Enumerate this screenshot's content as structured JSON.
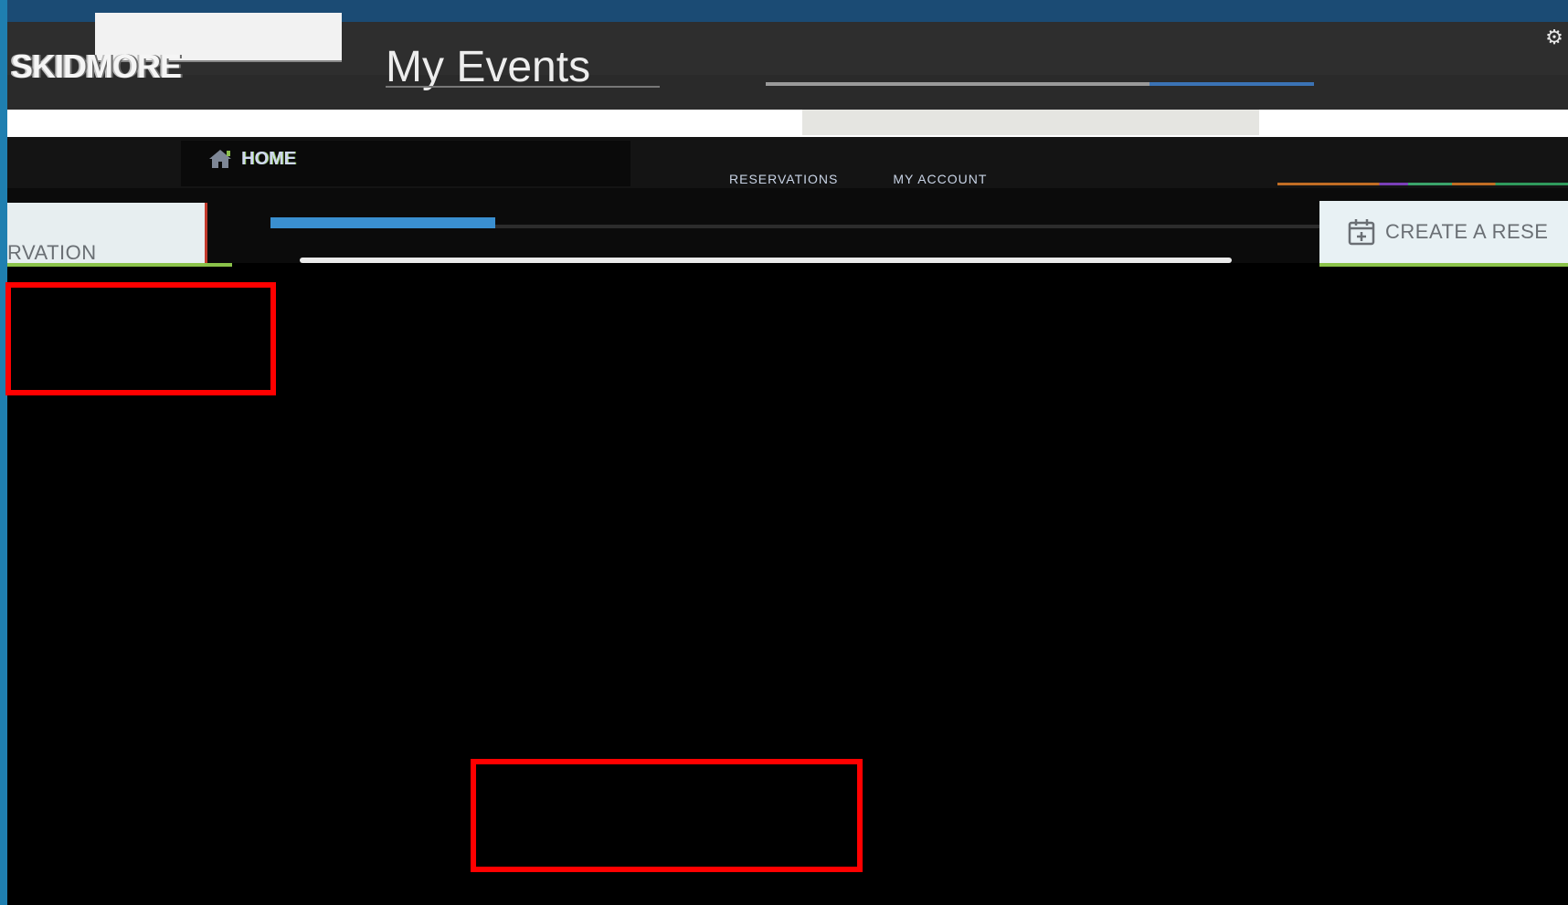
{
  "header": {
    "logo_text": "SKIDMORE",
    "page_title": "My Events"
  },
  "nav": {
    "home_label": "HOME",
    "tabs": [
      "RESERVATIONS",
      "MY ACCOUNT"
    ]
  },
  "actions": {
    "left_tab_label": "RVATION",
    "create_label": "CREATE A RESE"
  },
  "colors": {
    "accent_blue": "#3a8fd0",
    "accent_green": "#8bc34a",
    "highlight_red": "#ff0000"
  },
  "icons": {
    "home": "home-icon",
    "calendar": "calendar-add-icon",
    "settings": "gear-icon"
  }
}
